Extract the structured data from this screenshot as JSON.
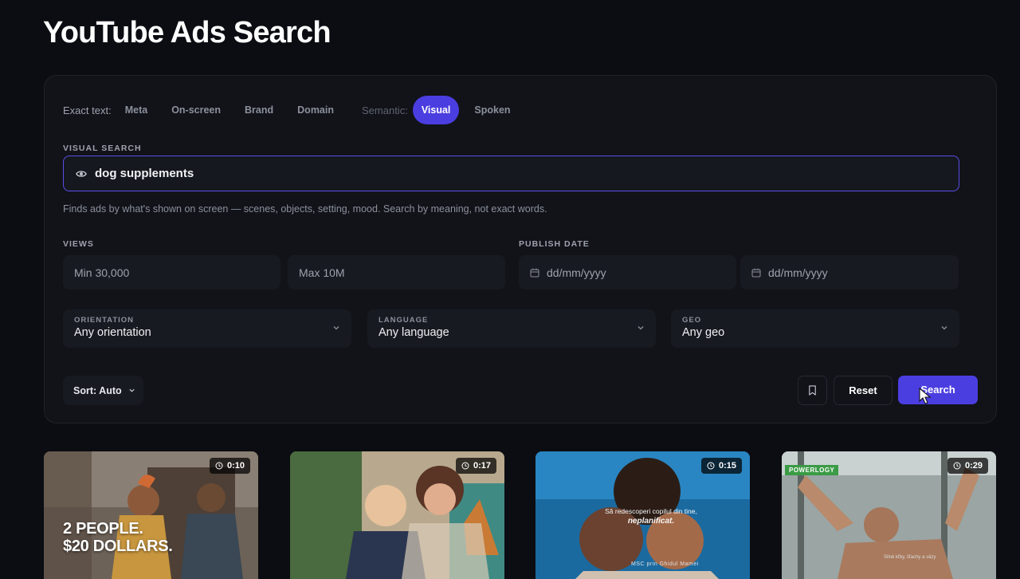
{
  "page_title": "YouTube Ads Search",
  "search_modes": {
    "exact_label": "Exact text:",
    "exact_options": [
      "Meta",
      "On-screen",
      "Brand",
      "Domain"
    ],
    "semantic_label": "Semantic:",
    "semantic_options": [
      "Visual",
      "Spoken"
    ],
    "active": "Visual"
  },
  "visual_search": {
    "label": "VISUAL SEARCH",
    "value": "dog supplements",
    "hint": "Finds ads by what's shown on screen — scenes, objects, setting, mood. Search by meaning, not exact words.",
    "icon": "eye-icon"
  },
  "views": {
    "label": "VIEWS",
    "min_placeholder": "Min 30,000",
    "max_placeholder": "Max 10M"
  },
  "publish_date": {
    "label": "PUBLISH DATE",
    "from_placeholder": "dd/mm/yyyy",
    "to_placeholder": "dd/mm/yyyy",
    "icon": "calendar-icon"
  },
  "filters": {
    "orientation": {
      "label": "ORIENTATION",
      "value": "Any orientation"
    },
    "language": {
      "label": "LANGUAGE",
      "value": "Any language"
    },
    "geo": {
      "label": "GEO",
      "value": "Any geo"
    }
  },
  "actions": {
    "sort_label": "Sort: Auto",
    "reset_label": "Reset",
    "search_label": "Search",
    "bookmark_icon": "bookmark-icon"
  },
  "results": [
    {
      "duration": "0:10",
      "overlay_line1": "2 PEOPLE.",
      "overlay_line2": "$20 DOLLARS."
    },
    {
      "duration": "0:17"
    },
    {
      "duration": "0:15",
      "caption_line1": "Să redescoperi copilul din tine,",
      "caption_line2": "neplanificat.",
      "logos": "MSC prin Ghidul Mamei"
    },
    {
      "duration": "0:29",
      "brand_badge": "POWERLOGY",
      "caption": "Silné kľby, šľachy a väzy"
    }
  ],
  "colors": {
    "accent": "#4b3ee0",
    "background": "#0b0d12",
    "panel": "#111319"
  }
}
